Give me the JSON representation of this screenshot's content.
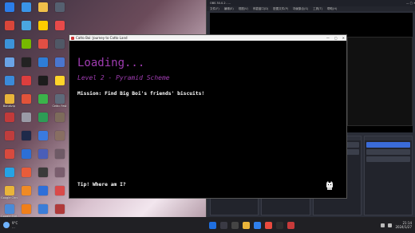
{
  "desktop": {
    "icons": [
      {
        "label": "",
        "color": "#2b7de9"
      },
      {
        "label": "",
        "color": "#3a95e8"
      },
      {
        "label": "",
        "color": "#f0c04a"
      },
      {
        "label": "",
        "color": "#556070"
      },
      {
        "label": "",
        "color": "#d9463a"
      },
      {
        "label": "",
        "color": "#4aa6e0"
      },
      {
        "label": "",
        "color": "#ffcc00"
      },
      {
        "label": "",
        "color": "#e84a4a"
      },
      {
        "label": "",
        "color": "#3c93d8"
      },
      {
        "label": "",
        "color": "#76b900"
      },
      {
        "label": "",
        "color": "#e14f44"
      },
      {
        "label": "",
        "color": "#505866"
      },
      {
        "label": "",
        "color": "#6aa3e6"
      },
      {
        "label": "",
        "color": "#222"
      },
      {
        "label": "",
        "color": "#2e7dd7"
      },
      {
        "label": "",
        "color": "#4a76cf"
      },
      {
        "label": "",
        "color": "#3b8ad9"
      },
      {
        "label": "",
        "color": "#dc3e3e"
      },
      {
        "label": "",
        "color": "#1c1c1c"
      },
      {
        "label": "",
        "color": "#ffd42a"
      },
      {
        "label": "Bandizip",
        "color": "#e9b43a"
      },
      {
        "label": "",
        "color": "#e2533a"
      },
      {
        "label": "",
        "color": "#3bb34a"
      },
      {
        "label": "Celtic Fest",
        "color": "#5e6a7a"
      },
      {
        "label": "",
        "color": "#c23a3a"
      },
      {
        "label": "",
        "color": "#9a9aa6"
      },
      {
        "label": "",
        "color": "#2d9c55"
      },
      {
        "label": "",
        "color": "#7d6b5b"
      },
      {
        "label": "",
        "color": "#bf3d3d"
      },
      {
        "label": "",
        "color": "#1e2a4a"
      },
      {
        "label": "",
        "color": "#3a7adf"
      },
      {
        "label": "",
        "color": "#886e62"
      },
      {
        "label": "",
        "color": "#d84a3e"
      },
      {
        "label": "",
        "color": "#2c6fd6"
      },
      {
        "label": "",
        "color": "#4a5eb8"
      },
      {
        "label": "",
        "color": "#6e5a66"
      },
      {
        "label": "",
        "color": "#25a3e5"
      },
      {
        "label": "",
        "color": "#e85c3a"
      },
      {
        "label": "",
        "color": "#3a3a3a"
      },
      {
        "label": "",
        "color": "#7a5e6e"
      },
      {
        "label": "Google Chrome",
        "color": "#e9b43a"
      },
      {
        "label": "",
        "color": "#f08a24"
      },
      {
        "label": "",
        "color": "#2e6fd8"
      },
      {
        "label": "",
        "color": "#d94a4a"
      },
      {
        "label": "Google Earth Pro",
        "color": "#4a8ad8"
      },
      {
        "label": "",
        "color": "#f07f1a"
      },
      {
        "label": "",
        "color": "#3b7dd8"
      },
      {
        "label": "",
        "color": "#b03a3a"
      }
    ]
  },
  "background_window": {
    "title": "OBS 30.0.2 - ...",
    "menu": [
      "文件(F)",
      "编辑(E)",
      "视图(V)",
      "停靠窗口(D)",
      "配置文件(P)",
      "场景集合(S)",
      "工具(T)",
      "帮助(H)"
    ]
  },
  "game": {
    "window_title": "Catto Boi: Journey to Catto Land",
    "loading_text": "Loading...",
    "level_text": "Level 2 - Pyramid Scheme",
    "mission_text": "Mission: Find Big Boi's friends' biscuits!",
    "tip_text": "Tip! Where am I?"
  },
  "taskbar": {
    "weather": "9°C",
    "weather_sub": "...",
    "time": "21:14",
    "date": "2024/1/27",
    "accent": "#6fb3ff"
  }
}
